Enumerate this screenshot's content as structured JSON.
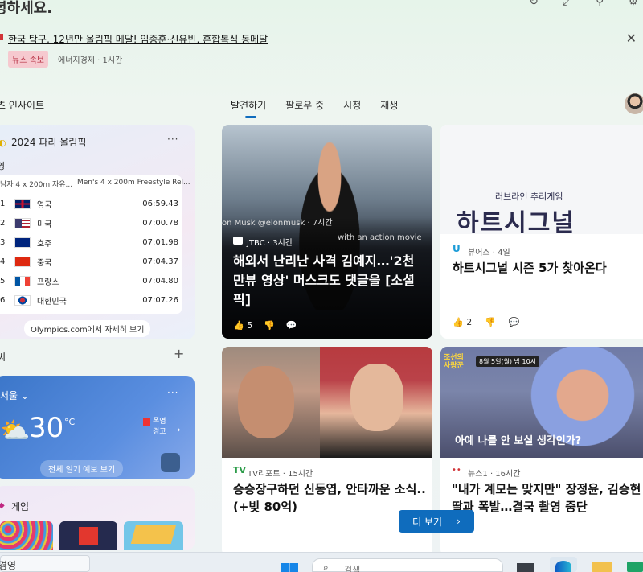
{
  "header": {
    "greeting": "녕하세요.",
    "icons": [
      "refresh-icon",
      "expand-icon",
      "user-switch-icon",
      "settings-icon"
    ]
  },
  "breaking_news": {
    "headline": "한국 탁구, 12년만 올림픽 메달! 임종훈·신유빈, 혼합복식 동메달",
    "badge": "뉴스 속보",
    "source": "에너지경제 · 1시간"
  },
  "insights": {
    "title": "츠 인사이트"
  },
  "tabs": [
    {
      "label": "발견하기",
      "active": true
    },
    {
      "label": "팔로우 중",
      "active": false
    },
    {
      "label": "시청",
      "active": false
    },
    {
      "label": "재생",
      "active": false
    }
  ],
  "olympics": {
    "title": "2024 파리 올림픽",
    "more": "···",
    "sport": "영",
    "event_left": "남자 4 x 200m 자유...",
    "event_right": "Men's 4 x 200m Freestyle Rel...",
    "rows": [
      {
        "rank": "1",
        "country": "영국",
        "time": "06:59.43",
        "flag": "uk"
      },
      {
        "rank": "2",
        "country": "미국",
        "time": "07:00.78",
        "flag": "us"
      },
      {
        "rank": "3",
        "country": "호주",
        "time": "07:01.98",
        "flag": "au"
      },
      {
        "rank": "4",
        "country": "중국",
        "time": "07:04.37",
        "flag": "cn"
      },
      {
        "rank": "5",
        "country": "프랑스",
        "time": "07:04.80",
        "flag": "fr"
      },
      {
        "rank": "6",
        "country": "대한민국",
        "time": "07:07.26",
        "flag": "kr"
      }
    ],
    "link": "Olympics.com에서 자세히 보기"
  },
  "weather_section": {
    "label": "씨",
    "plus": "+"
  },
  "weather": {
    "city": "서울",
    "more": "···",
    "temp": "30",
    "unit": "°C",
    "alert_line1": "폭염",
    "alert_line2": "경고",
    "forecast_button": "전체 일기 예보 보기"
  },
  "game": {
    "label": "게임"
  },
  "news": [
    {
      "tweet_line1": "on Musk  @elonmusk · 7시간",
      "tweet_line2": "with an action movie",
      "source": "JTBC · 3시간",
      "title": "해외서 난리난 사격 김예지…'2천만뷰 영상' 머스크도 댓글을 [소셜픽]",
      "likes": "5"
    },
    {
      "image_sub": "러브라인 추리게임",
      "image_logo": "하트시그널",
      "source_logo": "U",
      "source": "뷰어스 · 4일",
      "title": "하트시그널 시즌 5가 찾아온다",
      "likes": "2"
    },
    {
      "source_logo": "TV",
      "source": "TV리포트 · 15시간",
      "title": "승승장구하던 신동엽, 안타까운 소식.. (+빚 80억)"
    },
    {
      "image_tag": "조선의\n사랑꾼",
      "image_sub": "8월 5일(월) 밤 10시",
      "image_caption": "아예 나를 안 보실 생각인가?",
      "source_logo": "••",
      "source": "뉴스1 · 16시간",
      "title": "\"내가 계모는 맞지만\" 장정윤, 김승현 딸과 폭발…결국 촬영 중단"
    }
  ],
  "more_button": {
    "label": "더 보기",
    "arrow": "›"
  },
  "taskbar": {
    "search_left": "경영",
    "search_placeholder": "검색"
  }
}
